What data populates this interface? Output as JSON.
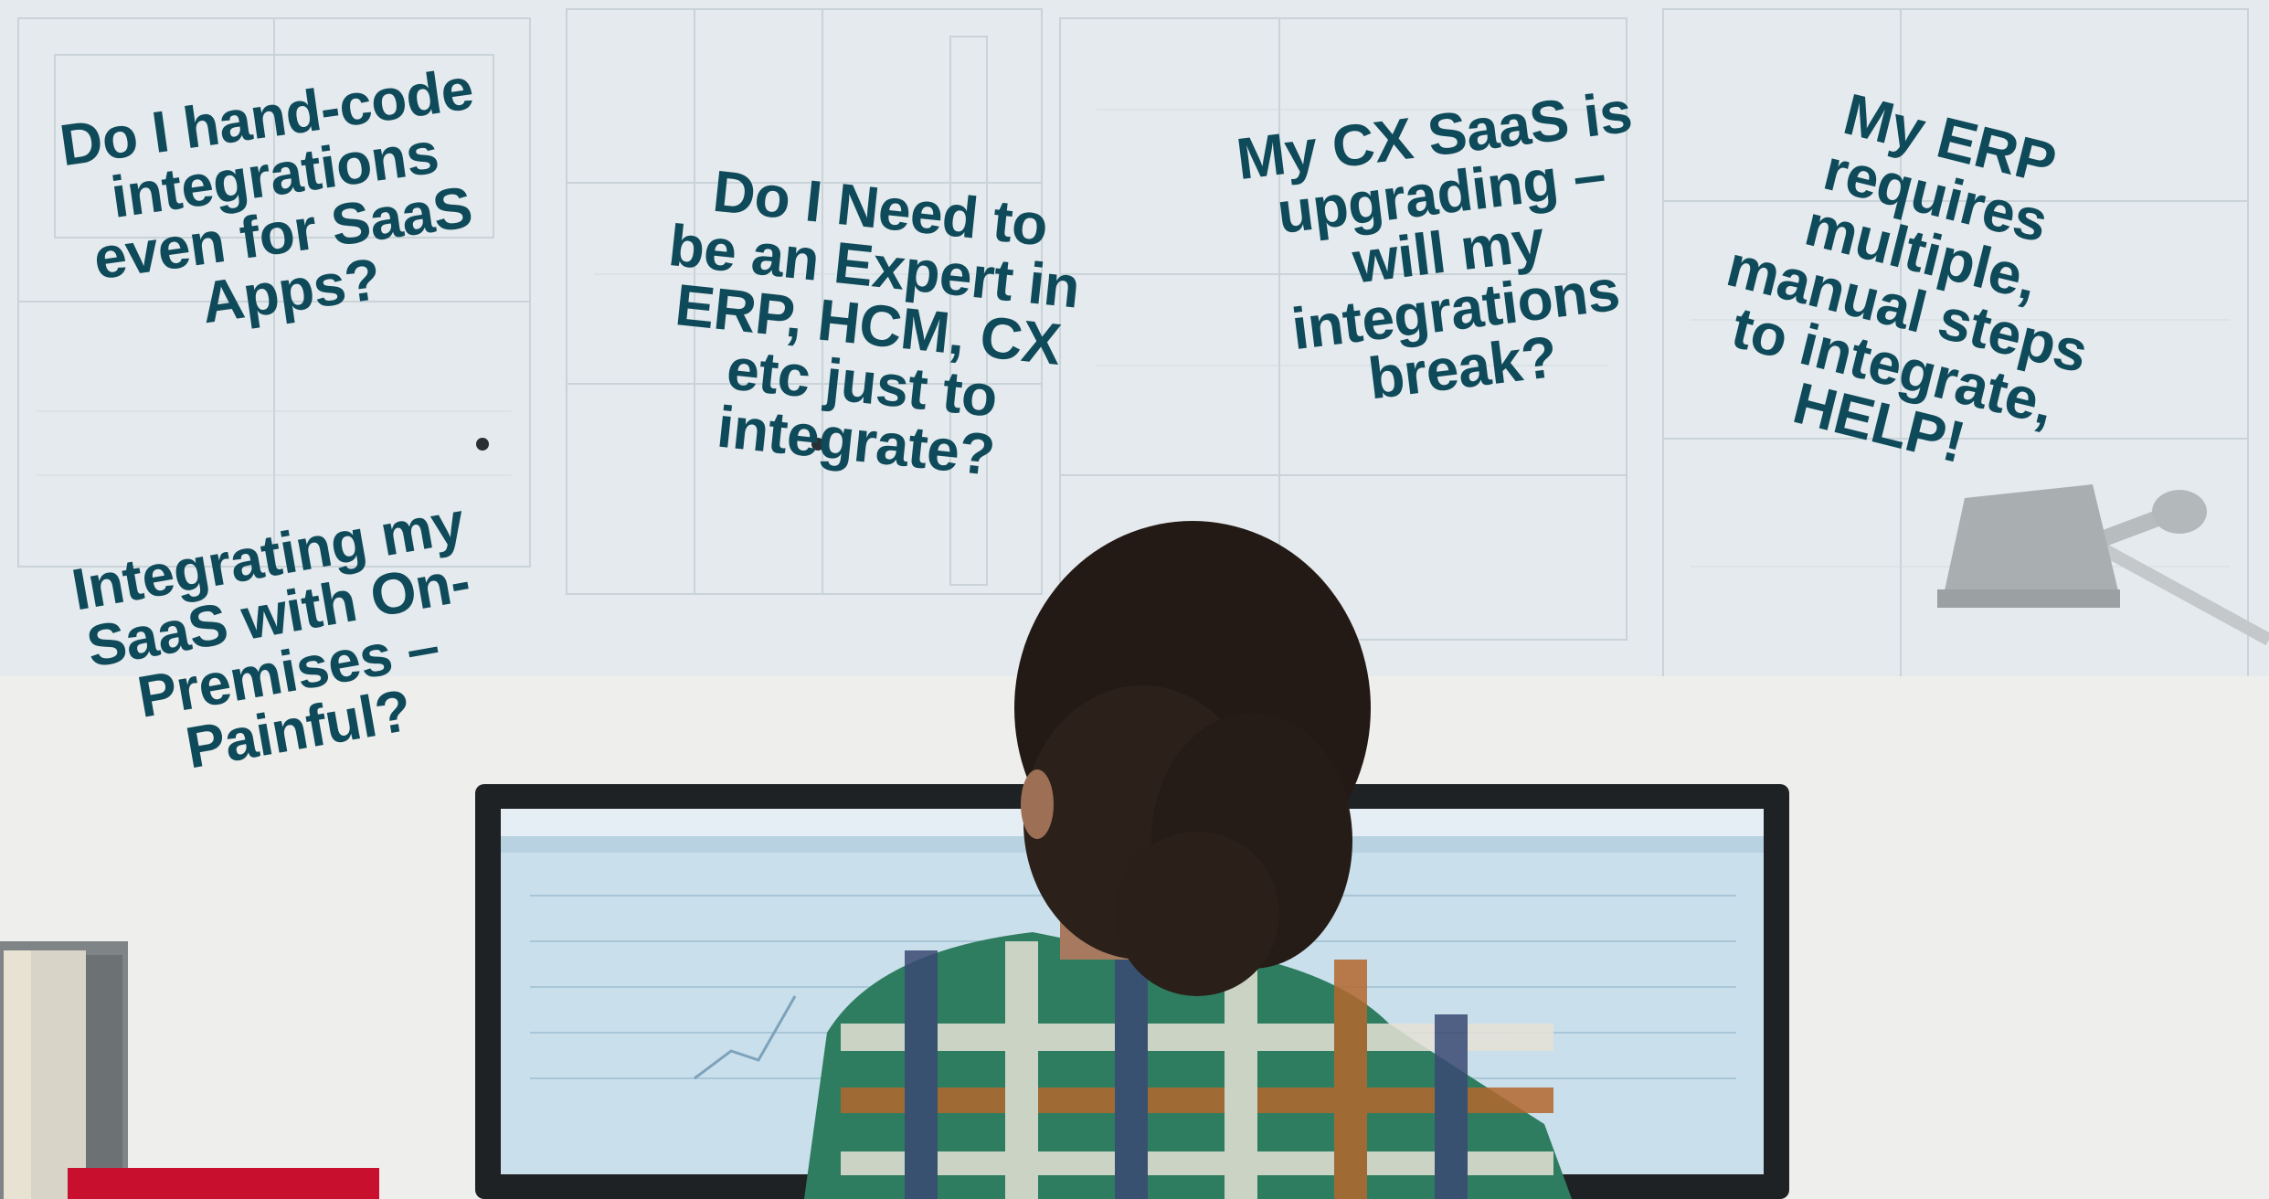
{
  "slide": {
    "questions": [
      "Do I hand-code\nintegrations\neven for SaaS\nApps?",
      "Do I Need to\nbe an Expert in\nERP, HCM, CX\netc just to\nintegrate?",
      "My CX SaaS is\nupgrading –\nwill my\nintegrations\nbreak?",
      "My ERP\nrequires\nmultiple,\nmanual steps\nto integrate,\nHELP!",
      "Integrating my\nSaaS with On-\nPremises –\nPainful?"
    ]
  },
  "colors": {
    "question_text": "#0f4a5a",
    "accent": "#c8102e",
    "background": "#e9eef0"
  },
  "photo": {
    "subject": "person with curly hair in green plaid shirt seen from behind, facing a computer monitor, blueprints on wall, desk lamp"
  }
}
